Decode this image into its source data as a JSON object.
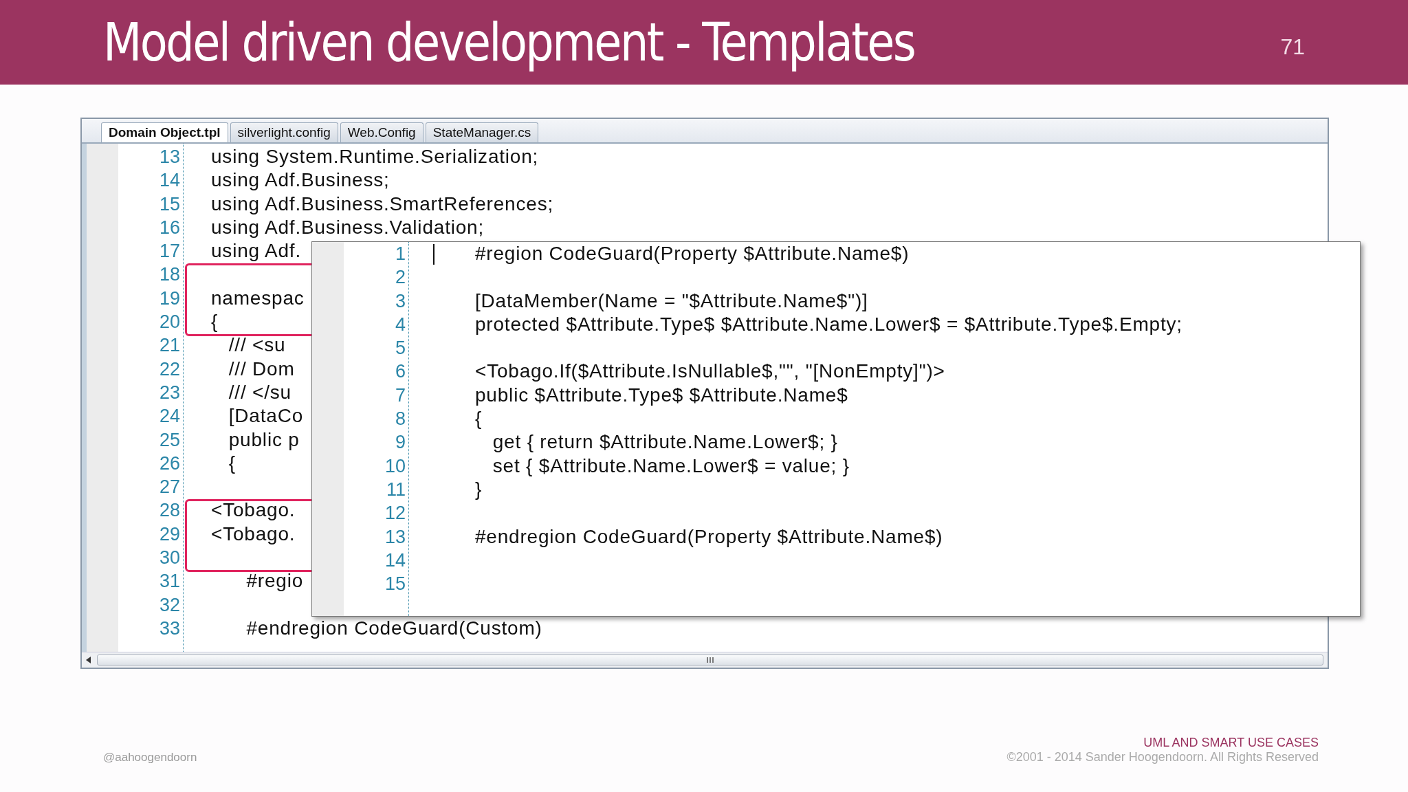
{
  "slide": {
    "title": "Model driven development - Templates",
    "page_number": "71"
  },
  "editor": {
    "tabs": [
      {
        "label": "Domain Object.tpl",
        "selected": true
      },
      {
        "label": "silverlight.config",
        "selected": false
      },
      {
        "label": "Web.Config",
        "selected": false
      },
      {
        "label": "StateManager.cs",
        "selected": false
      }
    ],
    "lines": [
      {
        "number": "13",
        "text": "using System.Runtime.Serialization;",
        "framed": false
      },
      {
        "number": "14",
        "text": "using Adf.Business;",
        "framed": false
      },
      {
        "number": "15",
        "text": "using Adf.Business.SmartReferences;",
        "framed": false
      },
      {
        "number": "16",
        "text": "using Adf.Business.Validation;",
        "framed": false
      },
      {
        "number": "17",
        "text": "using Adf.",
        "framed": false
      },
      {
        "number": "18",
        "framed": true
      },
      {
        "number": "19",
        "text": "namespac",
        "framed": true
      },
      {
        "number": "20",
        "text": "{",
        "framed": true
      },
      {
        "number": "21",
        "text": "   /// <su",
        "framed": false
      },
      {
        "number": "22",
        "text": "   /// Dom",
        "framed": false
      },
      {
        "number": "23",
        "text": "   /// </su",
        "framed": false
      },
      {
        "number": "24",
        "text": "   [DataCo",
        "framed": false
      },
      {
        "number": "25",
        "text": "   public p",
        "framed": false
      },
      {
        "number": "26",
        "text": "   {",
        "framed": false
      },
      {
        "number": "27",
        "framed": false
      },
      {
        "number": "28",
        "text": "<Tobago.",
        "framed": true
      },
      {
        "number": "29",
        "text": "<Tobago.",
        "framed": true
      },
      {
        "number": "30",
        "framed": true
      },
      {
        "number": "31",
        "text": "      #regio",
        "framed": false
      },
      {
        "number": "32",
        "framed": false
      },
      {
        "number": "33",
        "text": "      #endregion CodeGuard(Custom)",
        "framed": false
      }
    ],
    "popup": {
      "lines": [
        {
          "number": "1",
          "text": "#region CodeGuard(Property $Attribute.Name$)"
        },
        {
          "number": "2"
        },
        {
          "number": "3",
          "text": "[DataMember(Name = \"$Attribute.Name$\")]"
        },
        {
          "number": "4",
          "text": "protected $Attribute.Type$ $Attribute.Name.Lower$ = $Attribute.Type$.Empty;"
        },
        {
          "number": "5"
        },
        {
          "number": "6",
          "text": "<Tobago.If($Attribute.IsNullable$,\"\", \"[NonEmpty]\")>"
        },
        {
          "number": "7",
          "text": "public $Attribute.Type$ $Attribute.Name$"
        },
        {
          "number": "8",
          "text": "{"
        },
        {
          "number": "9",
          "text": "   get { return $Attribute.Name.Lower$; }"
        },
        {
          "number": "10",
          "text": "   set { $Attribute.Name.Lower$ = value; }"
        },
        {
          "number": "11",
          "text": "}"
        },
        {
          "number": "12"
        },
        {
          "number": "13",
          "text": "#endregion CodeGuard(Property $Attribute.Name$)"
        },
        {
          "number": "14"
        },
        {
          "number": "15"
        }
      ]
    }
  },
  "footer": {
    "handle": "@aahoogendoorn",
    "course": "UML AND SMART USE CASES",
    "copyright": "©2001 - 2014 Sander Hoogendoorn. All Rights Reserved"
  }
}
